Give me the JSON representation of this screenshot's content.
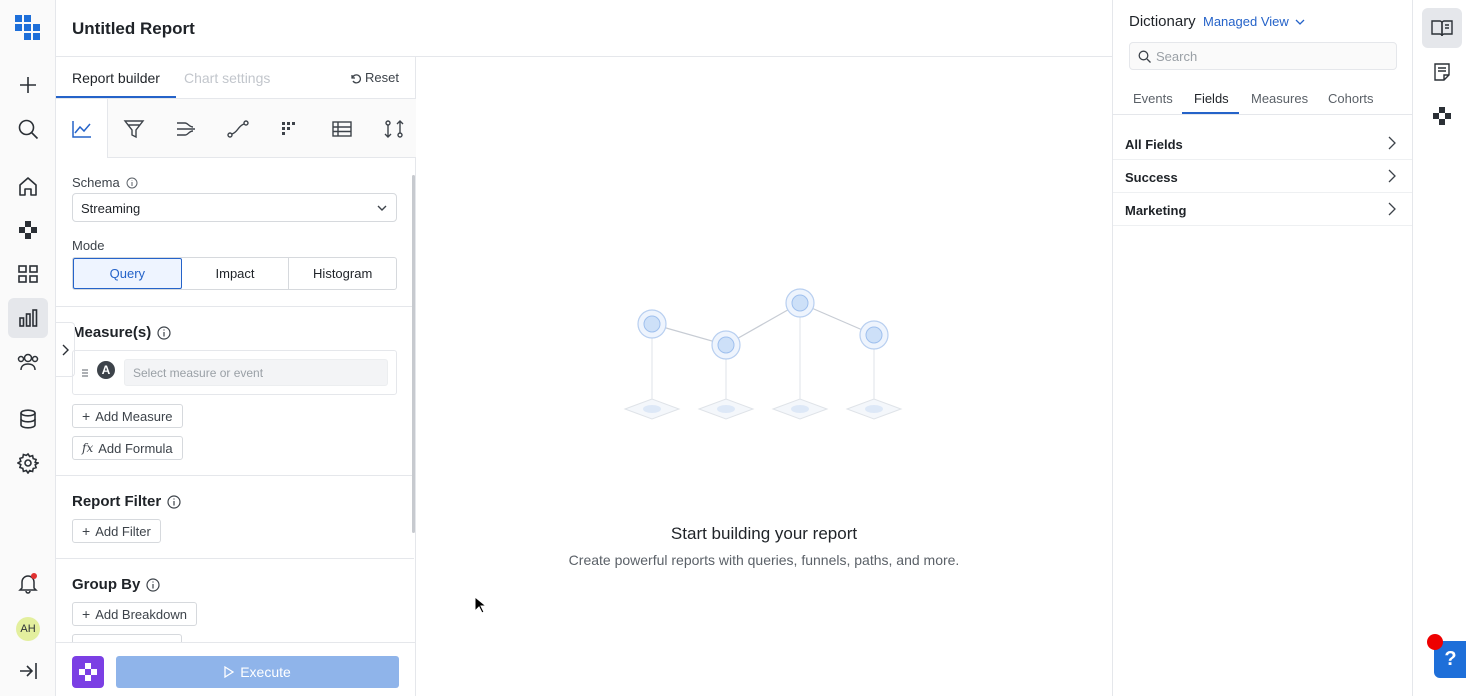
{
  "app": {
    "report_title": "Untitled Report",
    "user_initials": "AH"
  },
  "builder": {
    "tabs": {
      "report_builder": "Report builder",
      "chart_settings": "Chart settings"
    },
    "reset_label": "Reset",
    "schema": {
      "label": "Schema",
      "value": "Streaming"
    },
    "mode": {
      "label": "Mode",
      "options": [
        "Query",
        "Impact",
        "Histogram"
      ],
      "selected": "Query"
    },
    "measures": {
      "heading": "Measure(s)",
      "badge": "A",
      "placeholder": "Select measure or event",
      "add_measure": "Add Measure",
      "add_formula": "Add Formula"
    },
    "report_filter": {
      "heading": "Report Filter",
      "add_filter": "Add Filter"
    },
    "group_by": {
      "heading": "Group By",
      "add_breakdown": "Add Breakdown"
    },
    "execute_label": "Execute"
  },
  "canvas": {
    "empty_title": "Start building your report",
    "empty_subtitle": "Create powerful reports with queries, funnels, paths, and more."
  },
  "dictionary": {
    "title": "Dictionary",
    "view": "Managed View",
    "search_placeholder": "Search",
    "tabs": [
      "Events",
      "Fields",
      "Measures",
      "Cohorts"
    ],
    "active_tab": "Fields",
    "rows": [
      "All Fields",
      "Success",
      "Marketing"
    ]
  },
  "help": {
    "label": "?"
  },
  "colors": {
    "accent": "#2563c9",
    "execute": "#8fb4ea",
    "logo": "#7b3fe4",
    "help": "#1e6fd9"
  }
}
